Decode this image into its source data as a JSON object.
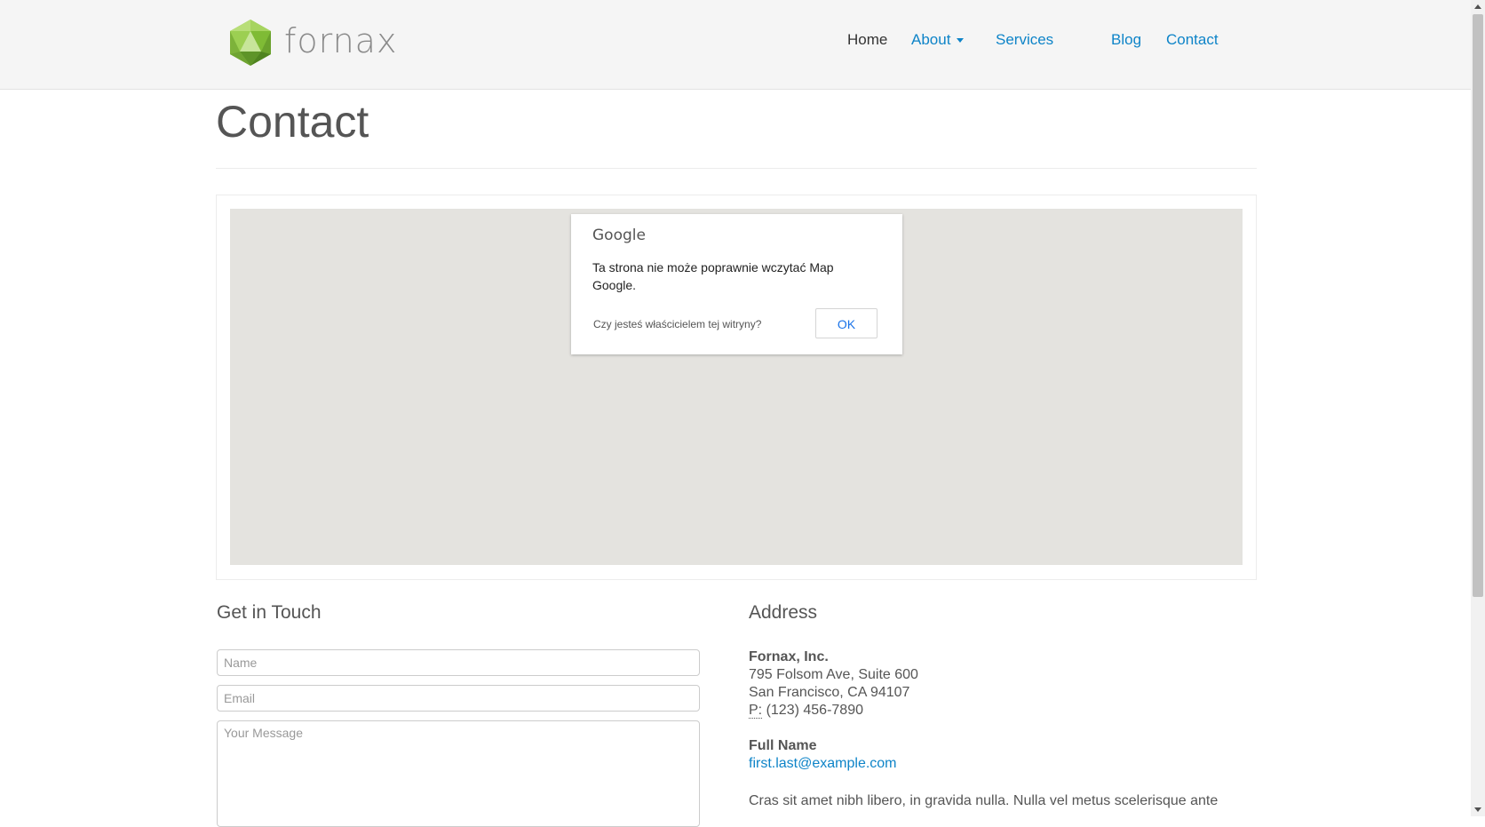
{
  "brand": {
    "name": "fornax",
    "logo_icon": "green-icosahedron-icon"
  },
  "nav": {
    "home": "Home",
    "about": "About",
    "services": "Services",
    "blog": "Blog",
    "contact": "Contact"
  },
  "page": {
    "title": "Contact"
  },
  "map": {
    "provider_logo": "Google",
    "error_message": "Ta strona nie może poprawnie wczytać Map Google.",
    "owner_question": "Czy jesteś właścicielem tej witryny?",
    "ok_label": "OK"
  },
  "contact_form": {
    "title": "Get in Touch",
    "name_placeholder": "Name",
    "email_placeholder": "Email",
    "message_placeholder": "Your Message"
  },
  "address": {
    "title": "Address",
    "company": "Fornax, Inc.",
    "street": "795 Folsom Ave, Suite 600",
    "city": "San Francisco, CA 94107",
    "phone_label": "P:",
    "phone": "(123) 456-7890",
    "person_name": "Full Name",
    "email": "first.last@example.com",
    "description": "Cras sit amet nibh libero, in gravida nulla. Nulla vel metus scelerisque ante"
  },
  "colors": {
    "link": "#0e84c8",
    "navbar_bg": "#f5f5f5",
    "map_bg": "#e4e3df",
    "logo_green": "#8cc63f"
  }
}
